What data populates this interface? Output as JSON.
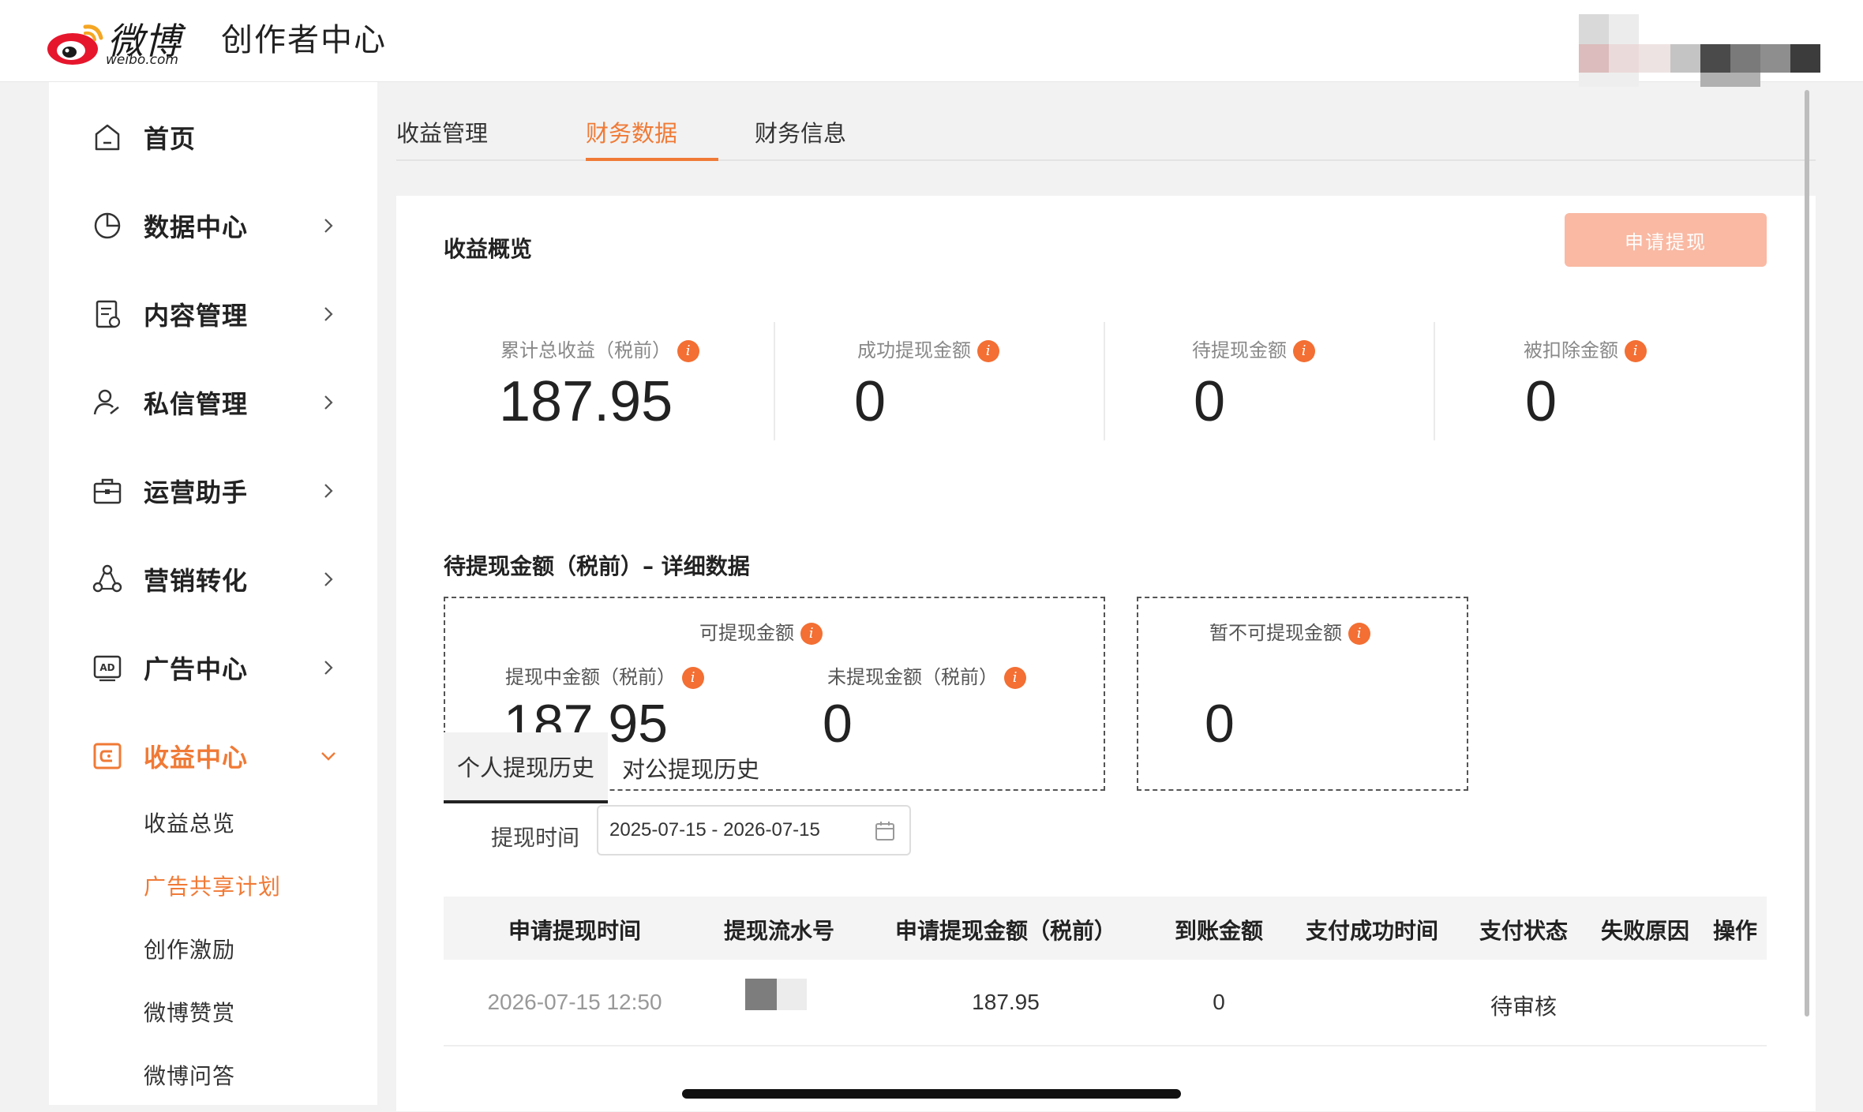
{
  "header": {
    "logo_word": "微博",
    "logo_domain": "weibo.com",
    "title": "创作者中心"
  },
  "sidebar": {
    "items": [
      {
        "label": "首页",
        "icon": "home-icon",
        "has_chevron": false
      },
      {
        "label": "数据中心",
        "icon": "pie-chart-icon",
        "has_chevron": true
      },
      {
        "label": "内容管理",
        "icon": "document-icon",
        "has_chevron": true
      },
      {
        "label": "私信管理",
        "icon": "user-message-icon",
        "has_chevron": true
      },
      {
        "label": "运营助手",
        "icon": "briefcase-icon",
        "has_chevron": true
      },
      {
        "label": "营销转化",
        "icon": "network-icon",
        "has_chevron": true
      },
      {
        "label": "广告中心",
        "icon": "ad-icon",
        "has_chevron": true
      },
      {
        "label": "收益中心",
        "icon": "wallet-icon",
        "has_chevron": true,
        "active": true
      }
    ],
    "sub_items": [
      {
        "label": "收益总览"
      },
      {
        "label": "广告共享计划",
        "active": true
      },
      {
        "label": "创作激励"
      },
      {
        "label": "微博赞赏"
      },
      {
        "label": "微博问答"
      }
    ]
  },
  "tabs": [
    {
      "label": "收益管理"
    },
    {
      "label": "财务数据",
      "active": true
    },
    {
      "label": "财务信息"
    }
  ],
  "overview": {
    "title": "收益概览",
    "apply_button": "申请提现",
    "stats": [
      {
        "label": "累计总收益（税前）",
        "value": "187.95"
      },
      {
        "label": "成功提现金额",
        "value": "0"
      },
      {
        "label": "待提现金额",
        "value": "0"
      },
      {
        "label": "被扣除金额",
        "value": "0"
      }
    ]
  },
  "detail": {
    "title": "待提现金额（税前）– 详细数据",
    "available": {
      "label": "可提现金额",
      "in_progress_label": "提现中金额（税前）",
      "in_progress_value": "187.95",
      "not_withdrawn_label": "未提现金额（税前）",
      "not_withdrawn_value": "0"
    },
    "unavailable": {
      "label": "暂不可提现金额",
      "value": "0"
    }
  },
  "history": {
    "tabs": [
      {
        "label": "个人提现历史",
        "active": true
      },
      {
        "label": "对公提现历史"
      }
    ],
    "filter_label": "提现时间",
    "date_range": "2025-07-15 - 2026-07-15",
    "columns": [
      "申请提现时间",
      "提现流水号",
      "申请提现金额（税前）",
      "到账金额",
      "支付成功时间",
      "支付状态",
      "失败原因",
      "操作"
    ],
    "rows": [
      {
        "time": "2026-07-15 12:50",
        "serial": "",
        "amount": "187.95",
        "received": "0",
        "paid_time": "",
        "status": "待审核",
        "reason": "",
        "action": ""
      }
    ]
  },
  "colors": {
    "accent": "#f07a36",
    "info_badge": "#f36f33",
    "apply_button_bg": "#f9b9a3"
  }
}
